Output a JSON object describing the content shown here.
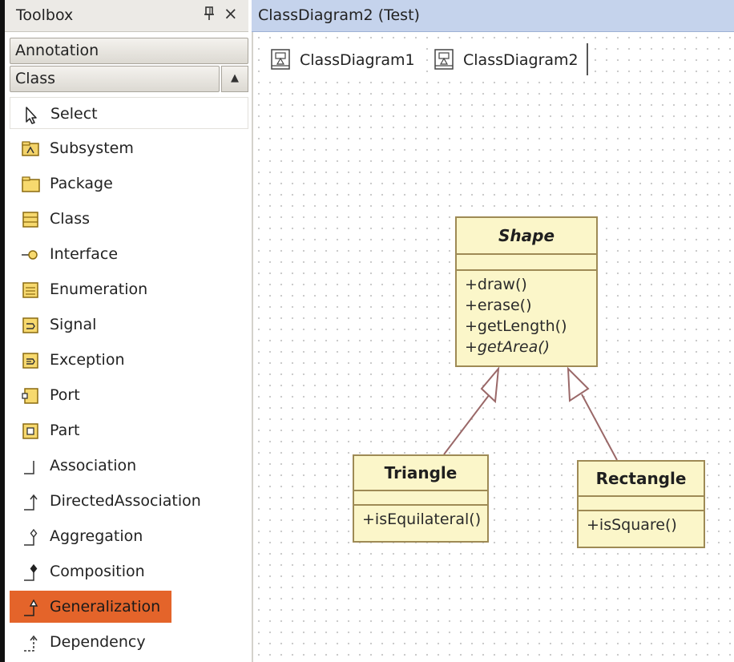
{
  "toolbox": {
    "title": "Toolbox",
    "pin_glyph": "▼",
    "close_glyph": "×",
    "sections": {
      "annotation": "Annotation",
      "class": "Class"
    },
    "scroll_glyph": "▲",
    "items": [
      {
        "label": "Select",
        "icon": "pointer-icon"
      },
      {
        "label": "Subsystem",
        "icon": "subsystem-icon"
      },
      {
        "label": "Package",
        "icon": "package-icon"
      },
      {
        "label": "Class",
        "icon": "class-icon"
      },
      {
        "label": "Interface",
        "icon": "interface-icon"
      },
      {
        "label": "Enumeration",
        "icon": "enumeration-icon"
      },
      {
        "label": "Signal",
        "icon": "signal-icon"
      },
      {
        "label": "Exception",
        "icon": "exception-icon"
      },
      {
        "label": "Port",
        "icon": "port-icon"
      },
      {
        "label": "Part",
        "icon": "part-icon"
      },
      {
        "label": "Association",
        "icon": "association-icon"
      },
      {
        "label": "DirectedAssociation",
        "icon": "directed-association-icon"
      },
      {
        "label": "Aggregation",
        "icon": "aggregation-icon"
      },
      {
        "label": "Composition",
        "icon": "composition-icon"
      },
      {
        "label": "Generalization",
        "icon": "generalization-icon",
        "selected": true
      },
      {
        "label": "Dependency",
        "icon": "dependency-icon"
      }
    ]
  },
  "document": {
    "title": "ClassDiagram2 (Test)",
    "tabs": [
      {
        "label": "ClassDiagram1"
      },
      {
        "label": "ClassDiagram2",
        "active": true
      }
    ]
  },
  "diagram": {
    "classes": {
      "shape": {
        "name": "Shape",
        "operations": [
          "+draw()",
          "+erase()",
          "+getLength()",
          "+getArea()"
        ]
      },
      "triangle": {
        "name": "Triangle",
        "operations": [
          "+isEquilateral()"
        ]
      },
      "rectangle": {
        "name": "Rectangle",
        "operations": [
          "+isSquare()"
        ]
      }
    }
  },
  "colors": {
    "selection": "#e4642a",
    "class_fill": "#fbf6c9",
    "class_border": "#9e8a55",
    "title_bar": "#c5d3ec"
  }
}
